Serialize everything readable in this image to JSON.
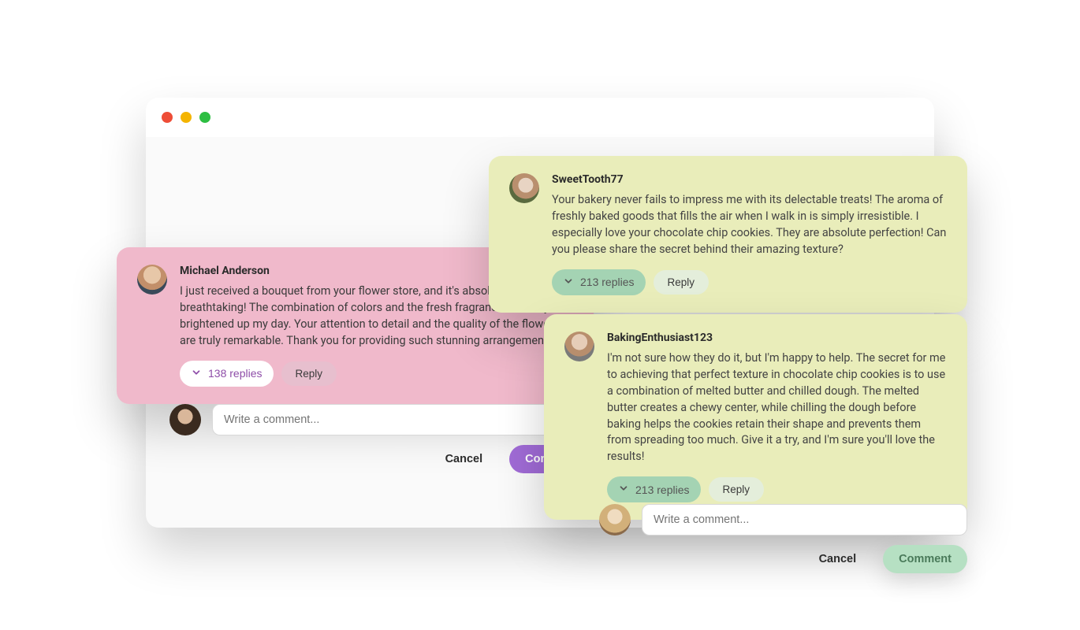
{
  "comments": {
    "pink": {
      "username": "Michael Anderson",
      "body": "I just received a bouquet from your flower store, and it's absolutely breathtaking! The combination of colors and the fresh fragrance instantly brightened up my day. Your attention to detail and the quality of the flowers are truly remarkable. Thank you for providing such stunning arrangements!",
      "replies_label": "138 replies",
      "reply_label": "Reply"
    },
    "green1": {
      "username": "SweetTooth77",
      "body": "Your bakery never fails to impress me with its delectable treats! The aroma of freshly baked goods that fills the air when I walk in is simply irresistible. I especially love your chocolate chip cookies. They are absolute perfection! Can you please share the secret behind their amazing texture?",
      "replies_label": "213 replies",
      "reply_label": "Reply"
    },
    "green2": {
      "username": "BakingEnthusiast123",
      "body": "I'm not sure how they do it, but I'm happy to help. The secret for me to achieving that perfect texture in chocolate chip cookies is to use a combination of melted butter and chilled dough. The melted butter creates a chewy center, while chilling the dough before baking helps the cookies retain their shape and prevents them from spreading too much. Give it a try, and I'm sure you'll love the results!",
      "replies_label": "213 replies",
      "reply_label": "Reply"
    }
  },
  "compose": {
    "placeholder": "Write a comment...",
    "cancel": "Cancel",
    "comment": "Comment"
  },
  "colors": {
    "pink_card": "#f0b9cb",
    "green_card": "#e9edba",
    "purple_btn": "#a06bd6",
    "green_btn": "#b6e0c3"
  }
}
